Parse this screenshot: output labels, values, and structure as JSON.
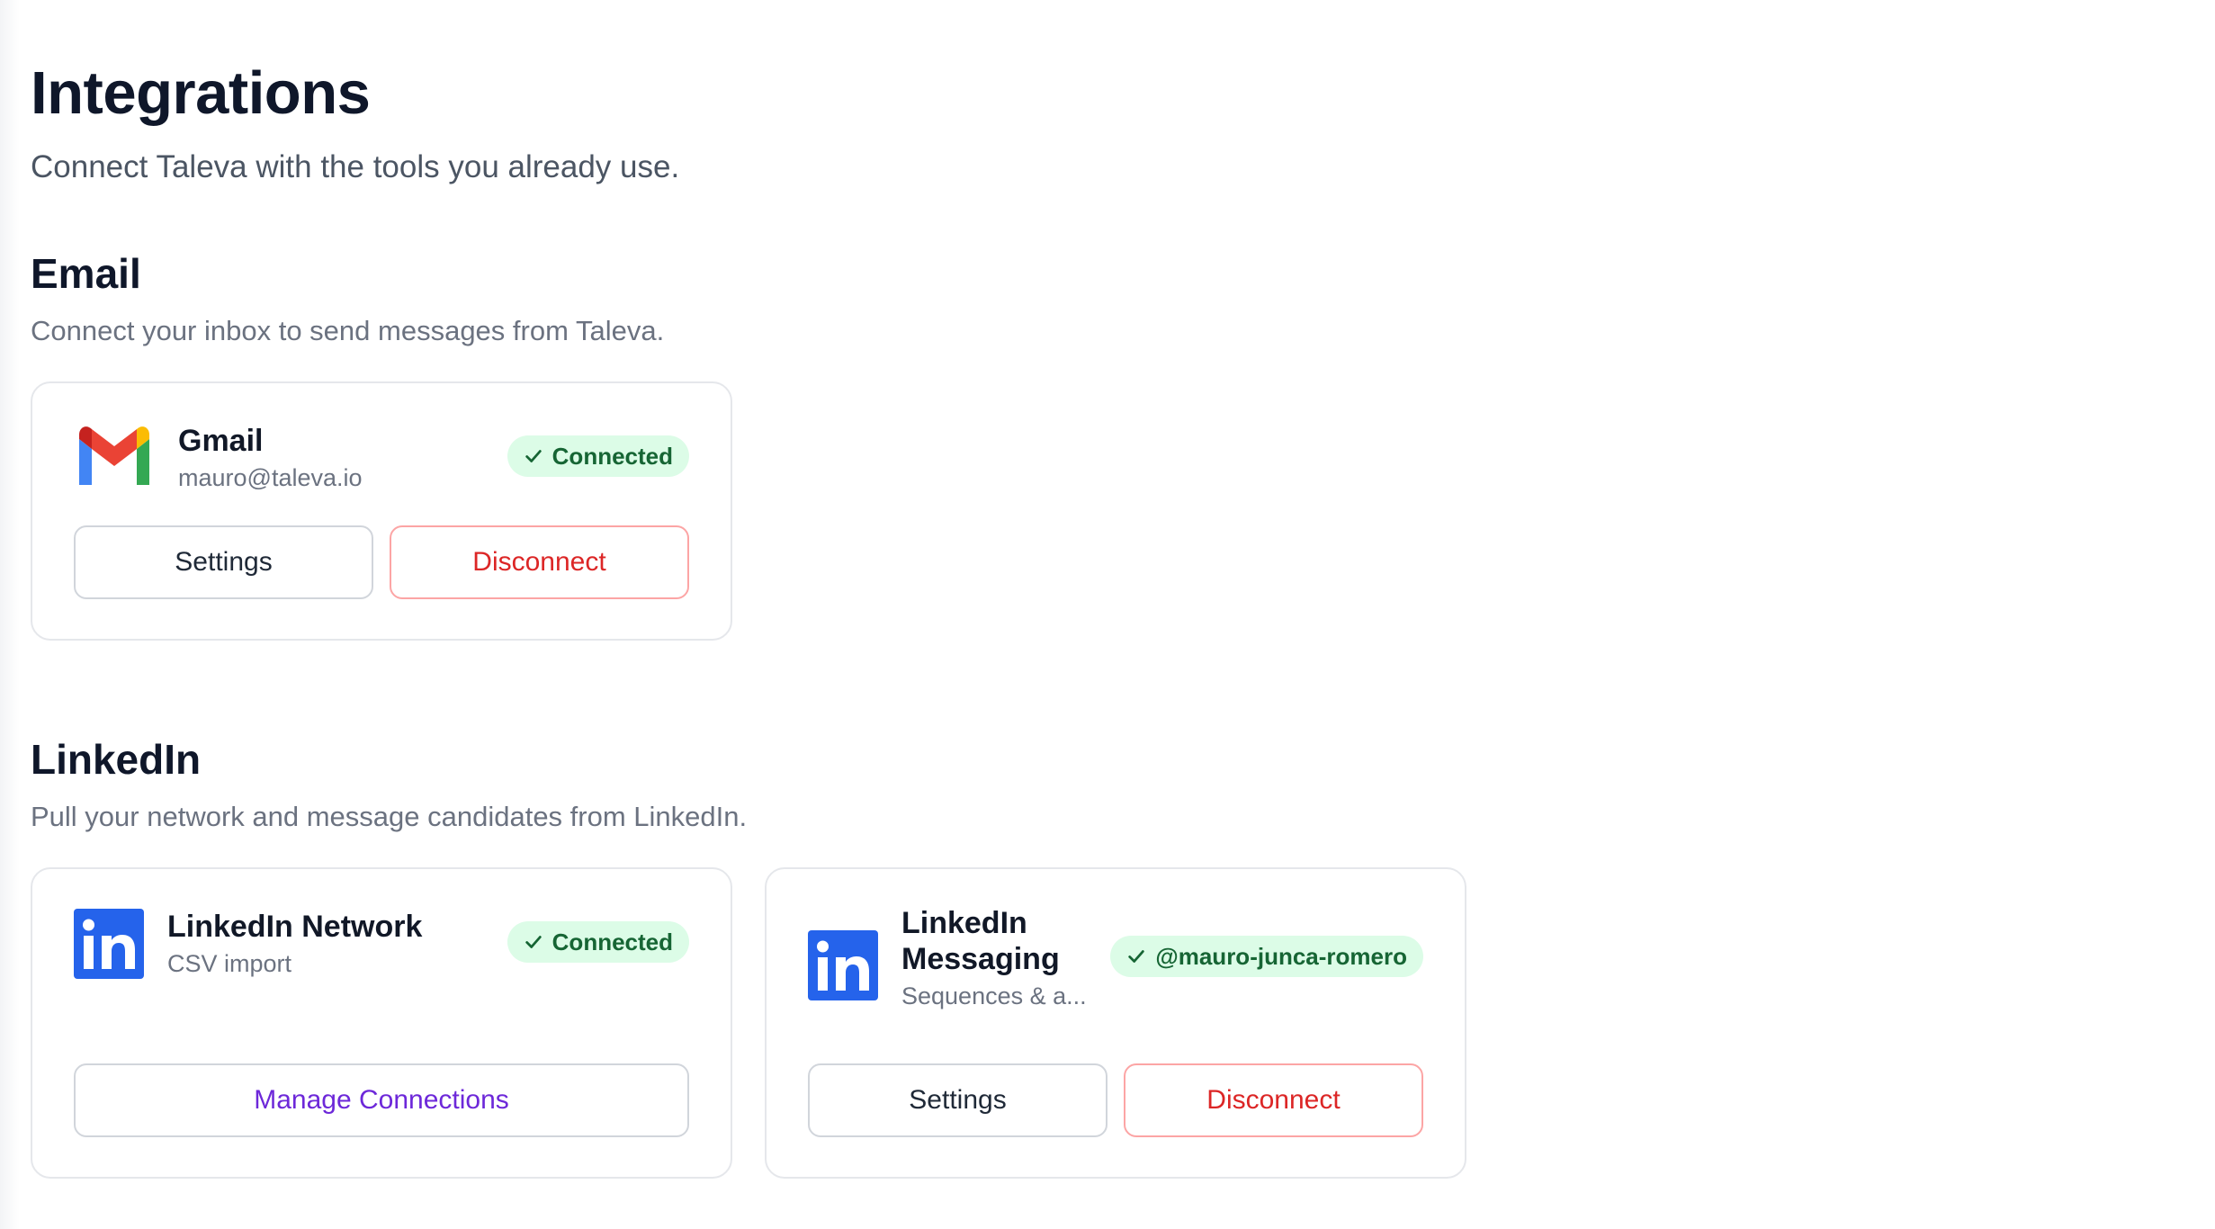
{
  "page": {
    "title": "Integrations",
    "subtitle": "Connect Taleva with the tools you already use."
  },
  "email": {
    "title": "Email",
    "description": "Connect your inbox to send messages from Taleva.",
    "gmail": {
      "name": "Gmail",
      "account": "mauro@taleva.io",
      "status": "Connected",
      "settings_label": "Settings",
      "disconnect_label": "Disconnect"
    }
  },
  "linkedin": {
    "title": "LinkedIn",
    "description": "Pull your network and message candidates from LinkedIn.",
    "network": {
      "name": "LinkedIn Network",
      "detail": "CSV import",
      "status": "Connected",
      "manage_label": "Manage Connections"
    },
    "messaging": {
      "name_line1": "LinkedIn",
      "name_line2": "Messaging",
      "detail": "Sequences & a...",
      "status": "@mauro-junca-romero",
      "settings_label": "Settings",
      "disconnect_label": "Disconnect"
    }
  },
  "colors": {
    "success_bg": "#dcfce7",
    "success_text": "#166534",
    "danger": "#dc2626",
    "accent_purple": "#6d28d9",
    "linkedin_blue": "#2563eb"
  },
  "icons": {
    "gmail": "gmail-logo-icon",
    "linkedin": "linkedin-logo-icon",
    "check": "check-icon"
  }
}
